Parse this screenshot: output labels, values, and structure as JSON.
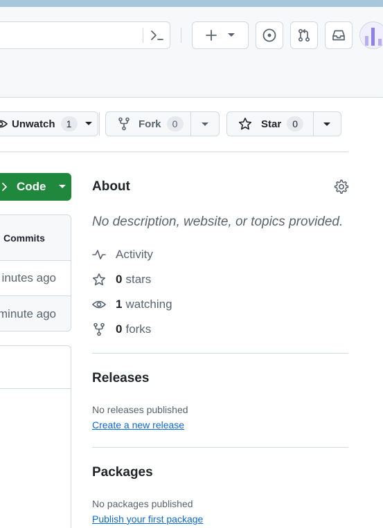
{
  "header": {
    "icons": [
      "command-palette-icon",
      "plus-icon",
      "chevron-down-icon",
      "issue-opened-icon",
      "git-pull-request-icon",
      "inbox-icon",
      "avatar"
    ]
  },
  "repo_actions": {
    "watch": {
      "label": "Unwatch",
      "count": "1"
    },
    "fork": {
      "label": "Fork",
      "count": "0"
    },
    "star": {
      "label": "Star",
      "count": "0"
    }
  },
  "code_button": {
    "label": "Code"
  },
  "files": {
    "commits_label": "Commits",
    "rows": [
      "inutes ago",
      "minute ago"
    ]
  },
  "about": {
    "title": "About",
    "description": "No description, website, or topics provided.",
    "activity_label": "Activity",
    "stars": {
      "count": "0",
      "label": "stars"
    },
    "watching": {
      "count": "1",
      "label": "watching"
    },
    "forks": {
      "count": "0",
      "label": "forks"
    }
  },
  "releases": {
    "title": "Releases",
    "note": "No releases published",
    "link": "Create a new release"
  },
  "packages": {
    "title": "Packages",
    "note": "No packages published",
    "link": "Publish your first package"
  },
  "colors": {
    "accent_green": "#1f883d",
    "link_blue": "#0969da",
    "muted_text": "#59636e",
    "border": "#d1d9e0"
  }
}
